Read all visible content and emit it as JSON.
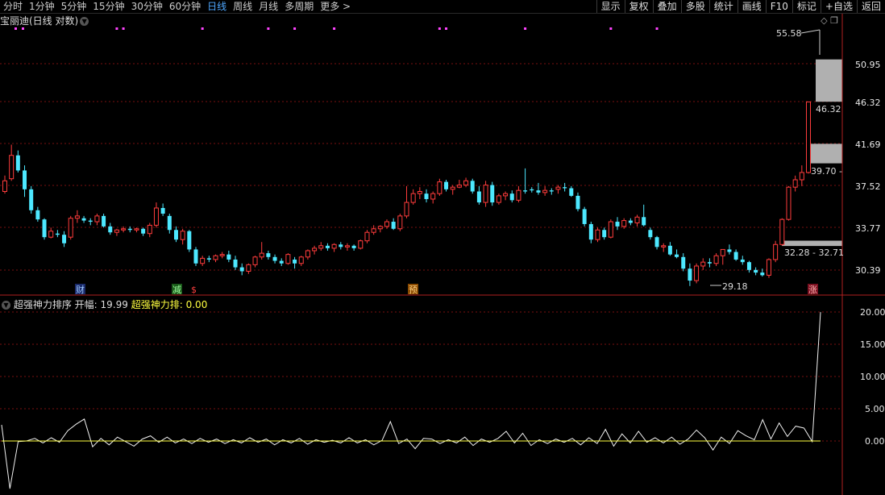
{
  "topbar": {
    "periods": [
      "分时",
      "1分钟",
      "5分钟",
      "15分钟",
      "30分钟",
      "60分钟",
      "日线",
      "周线",
      "月线",
      "多周期",
      "更多 >"
    ],
    "active_index": 6,
    "tools": [
      "显示",
      "复权",
      "叠加",
      "多股",
      "统计",
      "画线",
      "F10",
      "标记",
      "+自选",
      "返回"
    ]
  },
  "main": {
    "title": "宝丽迪(日线 对数)",
    "y_ticks": [
      "50.95",
      "46.32",
      "41.69",
      "37.52",
      "33.77",
      "30.39"
    ],
    "annotations": {
      "high": "55.58",
      "mark_46": "46.32",
      "mark_39": "39.70 -",
      "range": "32.28 - 32.71",
      "low": "29.18"
    },
    "event_labels": [
      "财",
      "减",
      "$",
      "预",
      "涨"
    ],
    "colors": {
      "up": "#ff3c3c",
      "down": "#4de8ff",
      "grid": "#7a1010",
      "event": "#ff44ff"
    }
  },
  "indicator": {
    "name": "超强神力排序",
    "field_label": "开幅:",
    "field_value": "19.99",
    "series_label": "超强神力排:",
    "series_value": "0.00",
    "y_ticks": [
      "20.00",
      "15.00",
      "10.00",
      "5.00",
      "0.00"
    ]
  },
  "chart_data": {
    "type": "line",
    "series": [
      {
        "name": "开幅",
        "values": [
          2.5,
          -7.4,
          -0.1,
          0,
          0.4,
          -0.3,
          0.5,
          -0.2,
          1.6,
          2.6,
          3.4,
          -0.9,
          0.4,
          -0.6,
          0.6,
          -0.1,
          -0.8,
          0.3,
          0.8,
          -0.2,
          0.6,
          -0.3,
          0.3,
          -0.4,
          0.4,
          -0.2,
          0.3,
          -0.4,
          0.2,
          -0.3,
          0.5,
          -0.2,
          0.3,
          -0.6,
          0.2,
          -0.3,
          0.4,
          -0.5,
          0.2,
          -0.2,
          0.1,
          -0.3,
          0.5,
          -0.3,
          0.2,
          -0.6,
          0.1,
          3.0,
          -0.4,
          0.3,
          -1.2,
          0.4,
          0.3,
          -0.4,
          0.2,
          -0.3,
          0.6,
          -0.7,
          0.3,
          -0.2,
          0.4,
          1.5,
          -0.3,
          1.2,
          -0.7,
          0.2,
          -0.4,
          0.3,
          -0.2,
          0.4,
          -0.6,
          0.5,
          -0.4,
          1.8,
          -0.8,
          1.1,
          -0.3,
          1.5,
          -0.2,
          0.5,
          -0.3,
          0.6,
          -0.5,
          0.3,
          1.7,
          0.5,
          -1.4,
          0.6,
          -0.4,
          1.6,
          0.8,
          0.2,
          3.3,
          0.3,
          2.8,
          0.7,
          2.3,
          2.0,
          -0.1,
          19.99
        ]
      },
      {
        "name": "超强神力排",
        "values": [
          0,
          0,
          0,
          0,
          0,
          0,
          0,
          0,
          0,
          0,
          0,
          0,
          0,
          0,
          0,
          0,
          0,
          0,
          0,
          0,
          0,
          0,
          0,
          0,
          0,
          0,
          0,
          0,
          0,
          0,
          0,
          0,
          0,
          0,
          0,
          0,
          0,
          0,
          0,
          0,
          0,
          0,
          0,
          0,
          0,
          0,
          0,
          0,
          0,
          0,
          0,
          0,
          0,
          0,
          0,
          0,
          0,
          0,
          0,
          0,
          0,
          0,
          0,
          0,
          0,
          0,
          0,
          0,
          0,
          0,
          0,
          0,
          0,
          0,
          0,
          0,
          0,
          0,
          0,
          0,
          0,
          0,
          0,
          0,
          0,
          0,
          0,
          0,
          0,
          0,
          0,
          0,
          0,
          0,
          0,
          0,
          0,
          0,
          0,
          0
        ]
      }
    ],
    "ylim": [
      -8,
      21
    ]
  },
  "candles": [
    [
      37.0,
      38.5,
      36.8,
      38.0
    ],
    [
      38.2,
      41.6,
      38.0,
      40.5
    ],
    [
      40.5,
      41.0,
      38.8,
      39.0
    ],
    [
      39.0,
      39.5,
      36.5,
      37.2
    ],
    [
      37.2,
      37.5,
      35.0,
      35.3
    ],
    [
      35.3,
      35.6,
      34.3,
      34.5
    ],
    [
      34.5,
      34.6,
      32.8,
      33.0
    ],
    [
      33.0,
      33.8,
      32.9,
      33.5
    ],
    [
      33.3,
      33.6,
      33.0,
      33.2
    ],
    [
      33.2,
      33.5,
      32.2,
      32.5
    ],
    [
      33.0,
      34.8,
      32.8,
      34.6
    ],
    [
      34.6,
      35.3,
      34.2,
      34.8
    ],
    [
      34.6,
      34.8,
      34.2,
      34.4
    ],
    [
      34.4,
      34.6,
      34.0,
      34.3
    ],
    [
      34.3,
      35.0,
      34.0,
      34.8
    ],
    [
      34.8,
      35.0,
      33.8,
      33.9
    ],
    [
      33.9,
      34.2,
      33.2,
      33.4
    ],
    [
      33.4,
      33.7,
      33.1,
      33.6
    ],
    [
      33.6,
      33.9,
      33.4,
      33.7
    ],
    [
      33.7,
      33.9,
      33.4,
      33.6
    ],
    [
      33.6,
      33.8,
      33.4,
      33.7
    ],
    [
      33.7,
      33.8,
      33.1,
      33.3
    ],
    [
      33.3,
      34.2,
      33.0,
      34.0
    ],
    [
      34.0,
      36.0,
      33.8,
      35.5
    ],
    [
      35.5,
      35.9,
      34.8,
      35.0
    ],
    [
      34.8,
      35.0,
      33.3,
      33.6
    ],
    [
      33.6,
      33.9,
      32.6,
      32.8
    ],
    [
      32.8,
      33.7,
      32.4,
      33.5
    ],
    [
      33.5,
      33.6,
      31.8,
      32.0
    ],
    [
      32.0,
      32.2,
      30.7,
      30.9
    ],
    [
      30.9,
      31.5,
      30.7,
      31.3
    ],
    [
      31.3,
      31.5,
      31.0,
      31.2
    ],
    [
      31.2,
      31.6,
      31.0,
      31.5
    ],
    [
      31.5,
      31.8,
      31.3,
      31.6
    ],
    [
      31.6,
      31.9,
      31.0,
      31.2
    ],
    [
      31.2,
      31.5,
      30.4,
      30.6
    ],
    [
      30.6,
      30.9,
      30.0,
      30.3
    ],
    [
      30.3,
      30.9,
      30.1,
      30.8
    ],
    [
      30.8,
      31.5,
      30.6,
      31.4
    ],
    [
      31.4,
      32.6,
      31.2,
      31.7
    ],
    [
      31.7,
      31.9,
      31.2,
      31.4
    ],
    [
      31.4,
      31.6,
      30.9,
      31.1
    ],
    [
      31.1,
      31.3,
      30.7,
      30.9
    ],
    [
      30.9,
      31.7,
      30.8,
      31.6
    ],
    [
      31.2,
      31.4,
      30.5,
      30.9
    ],
    [
      30.9,
      31.5,
      30.7,
      31.4
    ],
    [
      31.4,
      32.0,
      31.2,
      31.9
    ],
    [
      31.9,
      32.3,
      31.6,
      32.1
    ],
    [
      32.1,
      32.6,
      31.9,
      32.3
    ],
    [
      32.3,
      32.5,
      31.9,
      32.1
    ],
    [
      32.1,
      32.5,
      31.8,
      32.4
    ],
    [
      32.4,
      32.6,
      32.0,
      32.2
    ],
    [
      32.2,
      32.5,
      31.9,
      32.3
    ],
    [
      32.3,
      32.4,
      31.9,
      32.1
    ],
    [
      32.1,
      32.8,
      32.0,
      32.7
    ],
    [
      32.7,
      33.6,
      32.5,
      33.4
    ],
    [
      33.4,
      34.0,
      33.2,
      33.7
    ],
    [
      33.7,
      34.0,
      33.4,
      33.9
    ],
    [
      33.9,
      34.5,
      33.7,
      34.3
    ],
    [
      34.3,
      34.6,
      33.6,
      33.7
    ],
    [
      33.7,
      35.0,
      33.5,
      34.8
    ],
    [
      34.8,
      37.5,
      34.6,
      36.0
    ],
    [
      36.0,
      37.2,
      35.8,
      36.8
    ],
    [
      36.8,
      37.4,
      36.3,
      37.0
    ],
    [
      36.8,
      37.2,
      36.0,
      36.3
    ],
    [
      36.3,
      37.0,
      35.9,
      36.8
    ],
    [
      36.8,
      38.2,
      36.6,
      37.9
    ],
    [
      37.9,
      38.1,
      37.0,
      37.2
    ],
    [
      37.2,
      37.6,
      36.7,
      37.4
    ],
    [
      37.4,
      38.1,
      37.3,
      37.6
    ],
    [
      37.6,
      38.3,
      37.4,
      38.0
    ],
    [
      38.0,
      38.2,
      36.8,
      37.0
    ],
    [
      37.0,
      37.5,
      35.8,
      36.0
    ],
    [
      36.0,
      38.0,
      35.6,
      37.6
    ],
    [
      37.6,
      37.9,
      35.7,
      36.0
    ],
    [
      36.0,
      36.8,
      35.8,
      36.6
    ],
    [
      36.6,
      37.0,
      36.2,
      36.8
    ],
    [
      36.8,
      37.1,
      36.0,
      36.2
    ],
    [
      36.2,
      37.5,
      36.0,
      37.1
    ],
    [
      37.1,
      39.2,
      36.8,
      37.0
    ],
    [
      37.2,
      37.4,
      36.9,
      37.1
    ],
    [
      37.1,
      37.8,
      36.7,
      36.9
    ],
    [
      36.9,
      37.5,
      36.6,
      37.1
    ],
    [
      37.1,
      37.3,
      36.7,
      37.0
    ],
    [
      37.2,
      37.6,
      36.8,
      37.4
    ],
    [
      37.4,
      37.8,
      37.0,
      37.3
    ],
    [
      37.3,
      37.5,
      36.5,
      36.6
    ],
    [
      36.6,
      36.9,
      35.2,
      35.4
    ],
    [
      35.4,
      35.6,
      33.9,
      34.1
    ],
    [
      34.1,
      34.3,
      32.5,
      32.8
    ],
    [
      32.8,
      33.8,
      32.6,
      33.6
    ],
    [
      33.6,
      33.8,
      32.8,
      33.0
    ],
    [
      33.0,
      34.5,
      32.9,
      34.3
    ],
    [
      34.3,
      34.7,
      33.6,
      33.9
    ],
    [
      33.9,
      34.6,
      33.7,
      34.4
    ],
    [
      34.4,
      34.6,
      34.0,
      34.2
    ],
    [
      34.2,
      34.9,
      33.9,
      34.7
    ],
    [
      34.7,
      35.8,
      33.9,
      34.0
    ],
    [
      33.6,
      33.8,
      32.8,
      33.0
    ],
    [
      33.0,
      33.1,
      32.0,
      32.2
    ],
    [
      32.2,
      32.5,
      31.8,
      32.3
    ],
    [
      32.3,
      32.6,
      31.5,
      31.6
    ],
    [
      31.6,
      32.0,
      31.3,
      31.4
    ],
    [
      31.4,
      31.7,
      30.3,
      30.5
    ],
    [
      30.5,
      30.9,
      29.2,
      29.6
    ],
    [
      29.6,
      30.9,
      29.4,
      30.7
    ],
    [
      30.7,
      31.3,
      30.4,
      31.0
    ],
    [
      31.0,
      31.3,
      30.6,
      30.9
    ],
    [
      30.9,
      31.7,
      30.7,
      31.5
    ],
    [
      31.5,
      32.0,
      30.8,
      32.0
    ],
    [
      32.0,
      32.4,
      31.6,
      31.8
    ],
    [
      31.8,
      32.0,
      31.1,
      31.2
    ],
    [
      31.2,
      31.5,
      30.8,
      31.0
    ],
    [
      31.0,
      31.1,
      30.2,
      30.4
    ],
    [
      30.4,
      30.6,
      30.0,
      30.2
    ],
    [
      30.2,
      30.5,
      29.9,
      30.0
    ],
    [
      30.0,
      31.3,
      29.8,
      31.2
    ],
    [
      31.2,
      32.7,
      31.0,
      32.4
    ],
    [
      32.4,
      34.6,
      32.3,
      34.5
    ],
    [
      34.5,
      37.5,
      34.4,
      37.4
    ],
    [
      37.4,
      38.5,
      37.0,
      38.1
    ],
    [
      38.1,
      39.5,
      37.5,
      38.8
    ],
    [
      38.8,
      46.3,
      38.7,
      46.3
    ]
  ],
  "gaps": [
    {
      "label": "upper-gap",
      "low": 46.32,
      "high": 51.5
    },
    {
      "label": "middle-gap",
      "low": 39.7,
      "high": 41.69
    },
    {
      "label": "lower-gap",
      "low": 32.28,
      "high": 32.71
    }
  ],
  "events": [
    17,
    18,
    30,
    40,
    44,
    50,
    66,
    67,
    79,
    92,
    99
  ]
}
